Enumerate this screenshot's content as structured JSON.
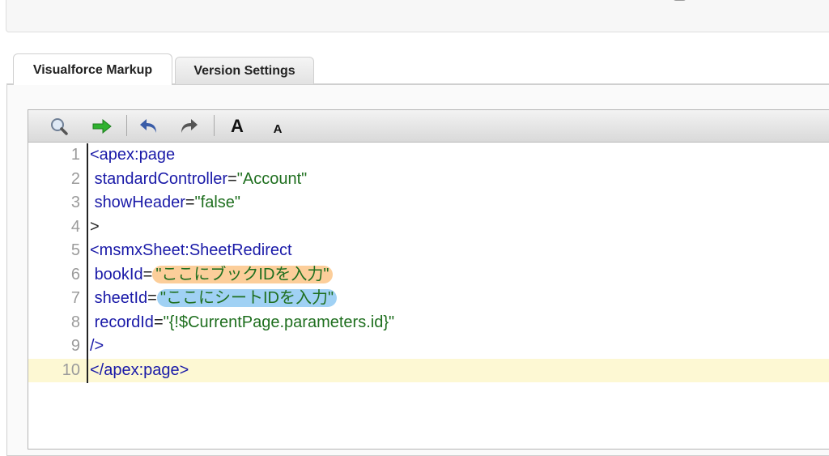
{
  "tabs": [
    {
      "label": "Visualforce Markup",
      "active": true
    },
    {
      "label": "Version Settings",
      "active": false
    }
  ],
  "toolbar": {
    "icons": [
      "search-icon",
      "go-to-line-icon",
      "undo-icon",
      "redo-icon",
      "font-larger-icon",
      "font-smaller-icon"
    ],
    "font_larger_label": "A",
    "font_smaller_label": "A"
  },
  "editor": {
    "line_numbers": [
      "1",
      "2",
      "3",
      "4",
      "5",
      "6",
      "7",
      "8",
      "9",
      "10"
    ],
    "lines": {
      "l1": "<apex:page",
      "l2_attr": "standardController",
      "l2_eq": "=",
      "l2_val": "\"Account\"",
      "l3_attr": "showHeader",
      "l3_eq": "=",
      "l3_val": "\"false\"",
      "l4": ">",
      "l5": "<msmxSheet:SheetRedirect",
      "l6_attr": "bookId",
      "l6_eq": "=",
      "l6_val": "\"ここにブックIDを入力\"",
      "l7_attr": "sheetId",
      "l7_eq": "=",
      "l7_val": "\"ここにシートIDを入力\"",
      "l8_attr": "recordId",
      "l8_eq": "=",
      "l8_val": "\"{!$CurrentPage.parameters.id}\"",
      "l9": "/>",
      "l10": "</apex:page>"
    },
    "highlight_colors": {
      "book_id": "#fab464",
      "sheet_id": "#78bef0",
      "current_line": "#fdf8d3"
    }
  }
}
